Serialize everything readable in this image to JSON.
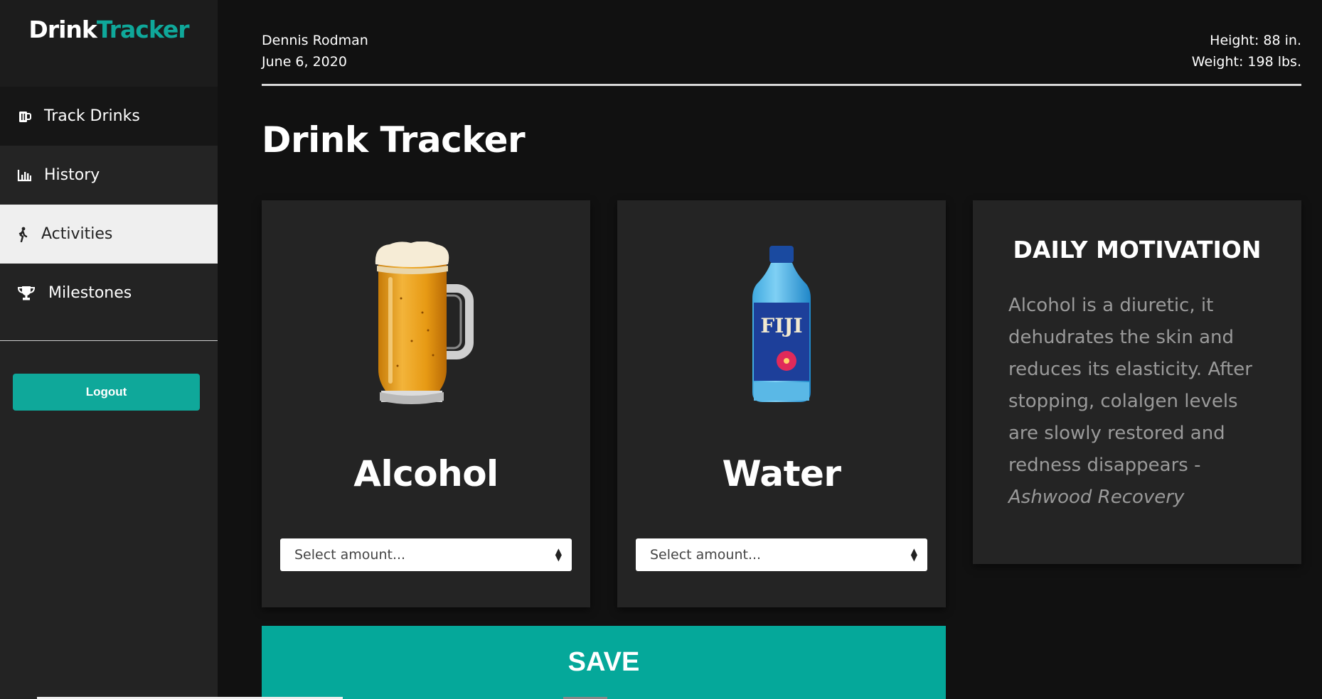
{
  "app": {
    "logo_part1": "Drink",
    "logo_part2": "Tracker",
    "brand_color": "#0fa89a"
  },
  "sidebar": {
    "items": [
      {
        "label": "Track Drinks",
        "icon": "beer-mug-icon"
      },
      {
        "label": "History",
        "icon": "bar-chart-icon"
      },
      {
        "label": "Activities",
        "icon": "walking-person-icon",
        "selected": true
      },
      {
        "label": "Milestones",
        "icon": "trophy-icon"
      }
    ],
    "logout_label": "Logout"
  },
  "header": {
    "user_name": "Dennis Rodman",
    "date": "June 6, 2020",
    "height": "Height: 88 in.",
    "weight": "Weight: 198 lbs."
  },
  "main": {
    "title": "Drink Tracker",
    "drinks": [
      {
        "name": "Alcohol",
        "image": "beer-mug-image",
        "select_placeholder": "Select amount..."
      },
      {
        "name": "Water",
        "image": "water-bottle-image",
        "bottle_label": "FIJI",
        "select_placeholder": "Select amount..."
      }
    ],
    "motivation": {
      "title": "DAILY MOTIVATION",
      "quote": "Alcohol is a diuretic, it dehudrates the skin and reduces its elasticity. After stopping, colalgen levels are slowly restored and redness disappears - ",
      "source": "Ashwood Recovery"
    },
    "save_label": "SAVE"
  }
}
